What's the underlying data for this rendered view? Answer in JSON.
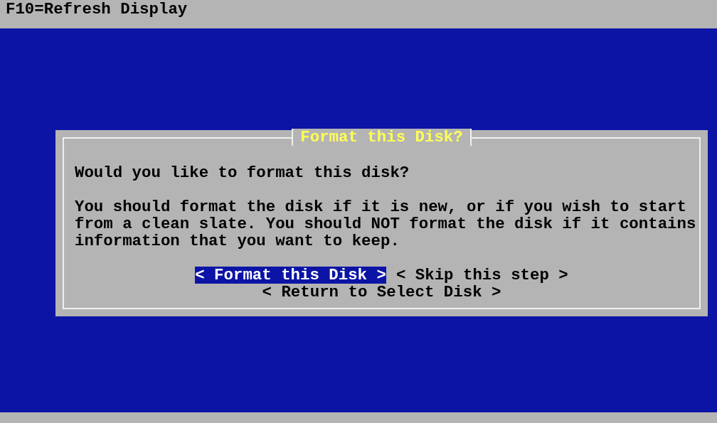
{
  "top_bar": {
    "text": "F10=Refresh Display"
  },
  "dialog": {
    "title": "Format this Disk?",
    "question": "Would you like to format this disk?",
    "message": "You should format the disk if it is new, or if you wish to start from a clean slate. You should NOT format the disk if it contains information that you want to keep.",
    "button_rows": [
      {
        "buttons": [
          {
            "label": "< Format this Disk >",
            "selected": true
          },
          {
            "label": "< Skip this step >",
            "selected": false
          }
        ]
      },
      {
        "buttons": [
          {
            "label": "< Return to Select Disk >",
            "selected": false
          }
        ]
      }
    ]
  }
}
